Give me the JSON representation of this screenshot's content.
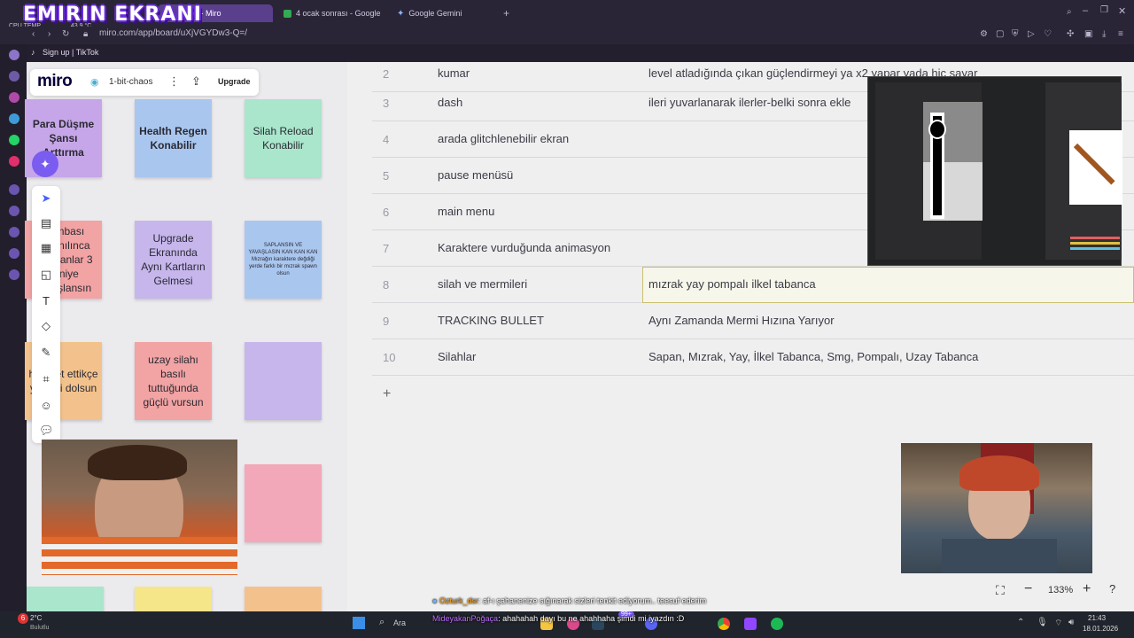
{
  "overlay_title": "EMIRIN EKRANI",
  "cpu_temp_label": "CPU TEMP",
  "cpu_temp_value": "43.9 °C",
  "browser": {
    "tabs": [
      {
        "label": "chaos - Miro",
        "active": true,
        "color": "#ffd02f"
      },
      {
        "label": "4 ocak sonrası - Google D",
        "active": false,
        "color": "#34a853"
      },
      {
        "label": "Google Gemini",
        "active": false,
        "color": "#8ab4f8"
      }
    ],
    "url": "miro.com/app/board/uXjVGYDw3-Q=/",
    "bookmark": "Sign up | TikTok"
  },
  "miro": {
    "logo": "miro",
    "board_name": "1-bit-chaos",
    "upgrade_label": "Upgrade",
    "zoom": "133%"
  },
  "stickies": [
    {
      "text": "Para Düşme Şansı Arttırma",
      "color": "#c6a6e8",
      "bold": true
    },
    {
      "text": "Health Regen Konabilir",
      "color": "#a9c6ef",
      "bold": true
    },
    {
      "text": "Silah Reload Konabilir",
      "color": "#a9e6cc",
      "bold": false
    },
    {
      "text": "Bombası kullanılınca düşmanlar 3 saniye yavaşlansın",
      "color": "#f2a3a3",
      "bold": false
    },
    {
      "text": "Upgrade Ekranında Aynı Kartların Gelmesi",
      "color": "#c6b6ec",
      "bold": false
    },
    {
      "text": "SAPLANSIN VE YAVAŞLASIN KAN KAN KAN\nMızrağın karaktere değdiği yerde farklı bir mızrak spawn olsun",
      "color": "#a9c6ef",
      "bold": false
    },
    {
      "text": "hareket ettikçe yetilesi dolsun",
      "color": "#f3c28c",
      "bold": false
    },
    {
      "text": "uzay silahı basılı tuttuğunda güçlü vursun",
      "color": "#f2a3a3",
      "bold": false
    },
    {
      "text": "",
      "color": "#c6b6ec",
      "bold": false
    },
    {
      "text": "",
      "color": "#f2a8b8",
      "bold": false
    }
  ],
  "table": [
    {
      "num": "2",
      "c1": "kumar",
      "c2": "level atladığında çıkan güçlendirmeyi ya x2 yapar yada hiç sayar"
    },
    {
      "num": "3",
      "c1": "dash",
      "c2": "ileri yuvarlanarak ilerler-belki sonra ekle"
    },
    {
      "num": "4",
      "c1": "arada glitchlenebilir ekran",
      "c2": ""
    },
    {
      "num": "5",
      "c1": "pause menüsü",
      "c2": ""
    },
    {
      "num": "6",
      "c1": "main menu",
      "c2": ""
    },
    {
      "num": "7",
      "c1": "Karaktere vurduğunda animasyon",
      "c2": ""
    },
    {
      "num": "8",
      "c1": "silah ve mermileri",
      "c2": "mızrak yay pompalı ilkel tabanca"
    },
    {
      "num": "9",
      "c1": "TRACKING BULLET",
      "c2": "Aynı Zamanda Mermi Hızına Yarıyor"
    },
    {
      "num": "10",
      "c1": "Silahlar",
      "c2": "Sapan, Mızrak, Yay, İlkel Tabanca, Smg, Pompalı, Uzay Tabanca"
    }
  ],
  "add_row_symbol": "+",
  "chat": {
    "msg1_user": "Ozturk_dsr",
    "msg1_text": ": af-ı şahanenize sığınarak sizleri tenkit ediyorum.. teesuf ederim",
    "msg2_user": "MideyakanPoğaça",
    "msg2_text": ": ahahahah dayı bu ne ahahhaha şimdi mi iyazdın :D"
  },
  "taskbar": {
    "weather": "2°C",
    "weather_sub": "Bulutlu",
    "search": "Ara",
    "time": "21:43",
    "date": "18.01.2026",
    "badge_count": "6",
    "badge2": "99+"
  }
}
